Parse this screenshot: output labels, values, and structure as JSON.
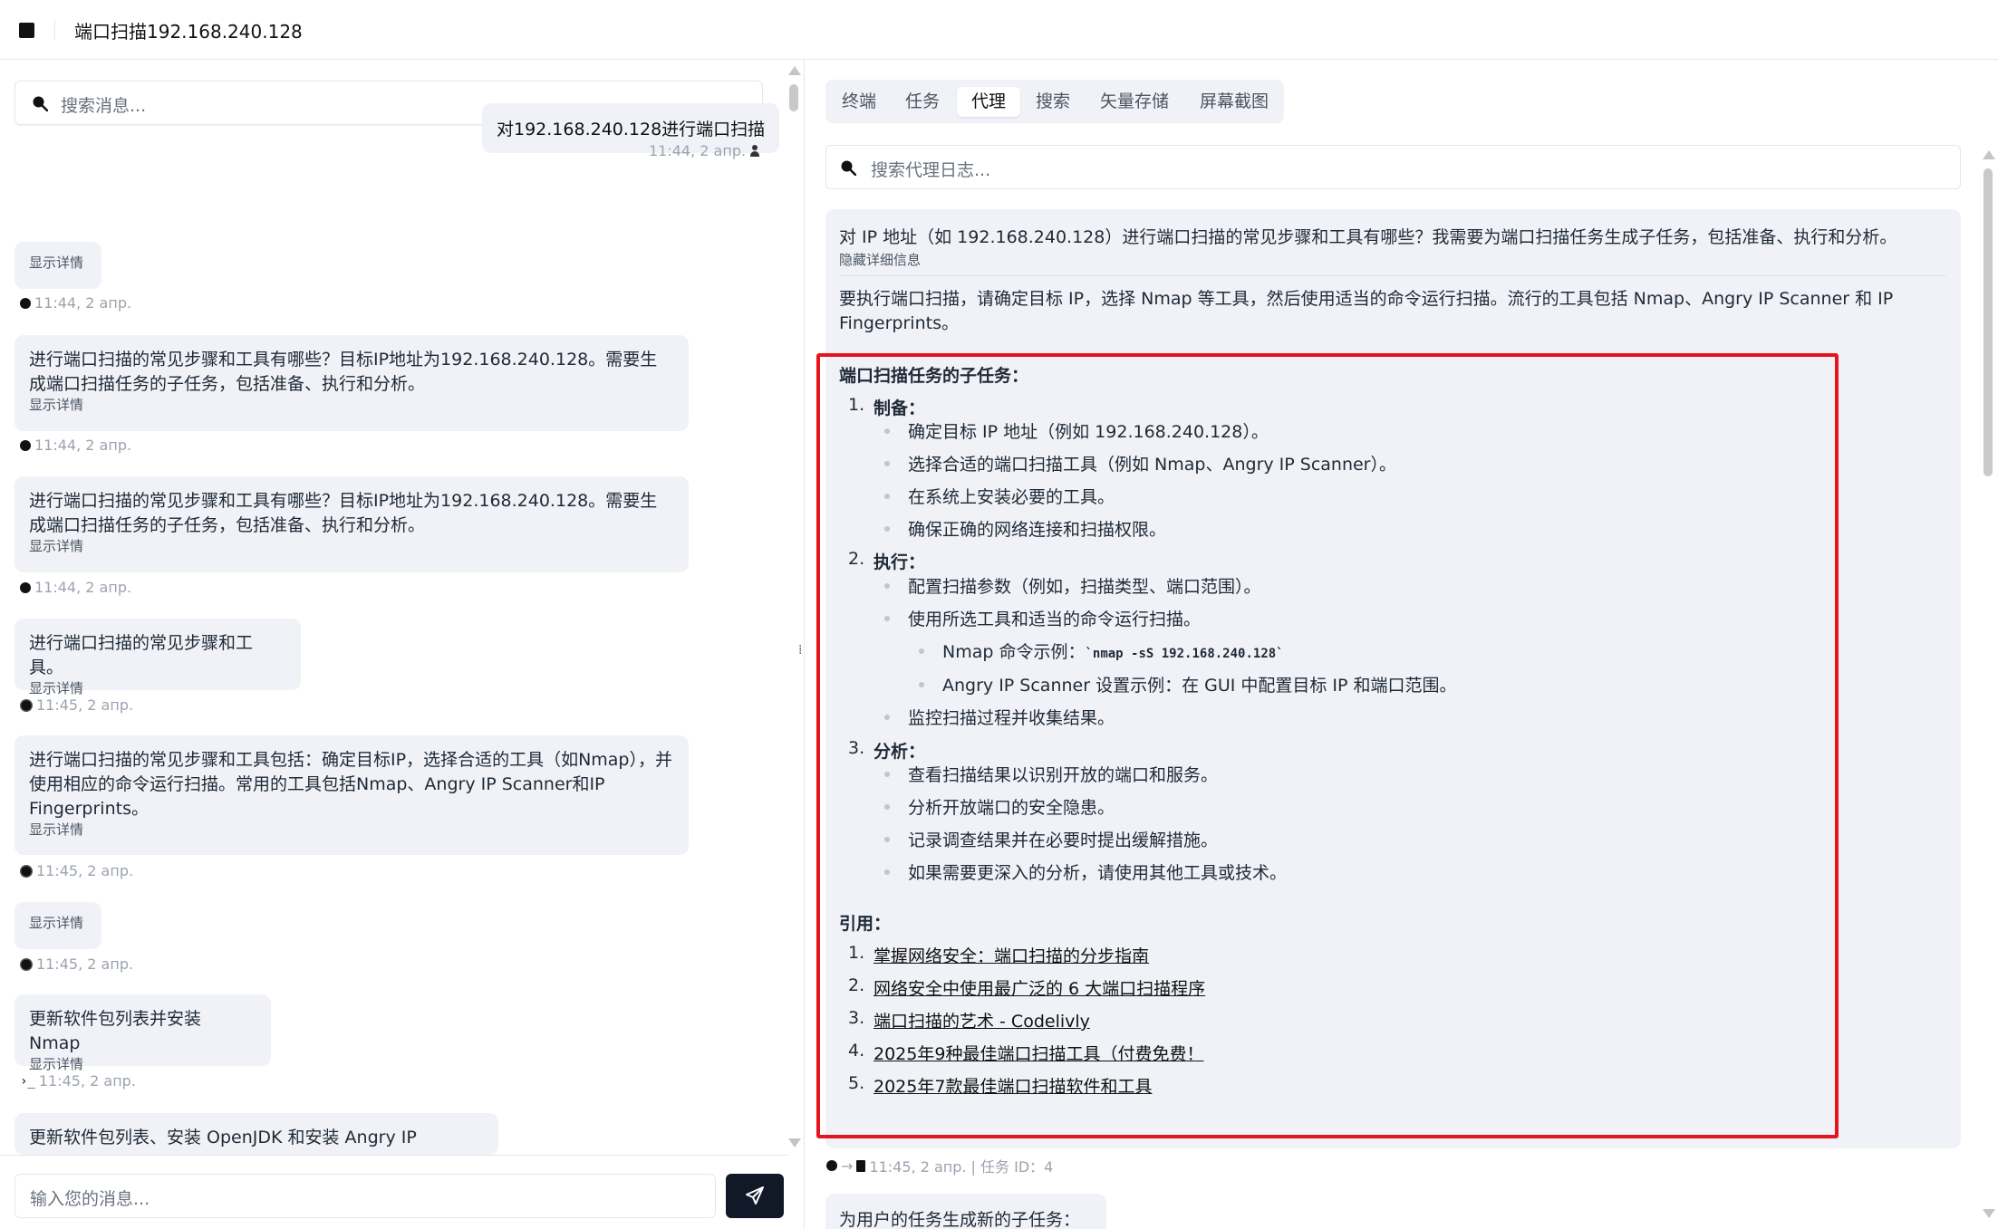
{
  "window": {
    "title": "端口扫描192.168.240.128"
  },
  "left": {
    "search_placeholder": "搜索消息...",
    "input_placeholder": "输入您的消息...",
    "user_message": {
      "text": "对192.168.240.128进行端口扫描",
      "time": "11:44, 2 апр."
    },
    "messages": [
      {
        "text": "",
        "detail": "显示详情",
        "time": "11:44, 2 апр.",
        "icon": "search-icon"
      },
      {
        "text": "进行端口扫描的常见步骤和工具有哪些？目标IP地址为192.168.240.128。需要生成端口扫描任务的子任务，包括准备、执行和分析。",
        "detail": "显示详情",
        "time": "11:44, 2 апр.",
        "icon": "search-icon"
      },
      {
        "text": "进行端口扫描的常见步骤和工具有哪些？目标IP地址为192.168.240.128。需要生成端口扫描任务的子任务，包括准备、执行和分析。",
        "detail": "显示详情",
        "time": "11:44, 2 апр.",
        "icon": "search-icon"
      },
      {
        "text": "进行端口扫描的常见步骤和工具。",
        "detail": "显示详情",
        "time": "11:45, 2 апр.",
        "icon": "ai-icon"
      },
      {
        "text": "进行端口扫描的常见步骤和工具包括：确定目标IP，选择合适的工具（如Nmap），并使用相应的命令运行扫描。常用的工具包括Nmap、Angry IP Scanner和IP Fingerprints。",
        "detail": "显示详情",
        "time": "11:45, 2 апр.",
        "icon": "ai-icon"
      },
      {
        "text": "",
        "detail": "显示详情",
        "time": "11:45, 2 апр.",
        "icon": "ai-icon"
      },
      {
        "text": "更新软件包列表并安装 Nmap",
        "detail": "显示详情",
        "time": "11:45, 2 апр.",
        "icon": "terminal-icon"
      },
      {
        "text": "更新软件包列表、安装 OpenJDK 和安装 Angry IP Scanner",
        "detail": "",
        "time": "",
        "icon": ""
      }
    ]
  },
  "right": {
    "tabs": [
      "终端",
      "任务",
      "代理",
      "搜索",
      "矢量存储",
      "屏幕截图"
    ],
    "active_tab": "代理",
    "search_placeholder": "搜索代理日志...",
    "card": {
      "question": "对 IP 地址（如 192.168.240.128）进行端口扫描的常见步骤和工具有哪些？我需要为端口扫描任务生成子任务，包括准备、执行和分析。",
      "hide_label": "隐藏详细信息",
      "answer": "要执行端口扫描，请确定目标 IP，选择 Nmap 等工具，然后使用适当的命令运行扫描。流行的工具包括 Nmap、Angry IP Scanner 和 IP Fingerprints。",
      "subtasks_heading": "端口扫描任务的子任务：",
      "sections": [
        {
          "num": "1.",
          "title": "制备：",
          "items": [
            "确定目标 IP 地址（例如 192.168.240.128）。",
            "选择合适的端口扫描工具（例如 Nmap、Angry IP Scanner）。",
            "在系统上安装必要的工具。",
            "确保正确的网络连接和扫描权限。"
          ]
        },
        {
          "num": "2.",
          "title": "执行：",
          "items": [
            "配置扫描参数（例如，扫描类型、端口范围）。",
            "使用所选工具和适当的命令运行扫描。",
            "监控扫描过程并收集结果。"
          ],
          "sub_items": {
            "nmap_label": "Nmap 命令示例：",
            "nmap_cmd": "`nmap -sS 192.168.240.128`",
            "angry": "Angry IP Scanner 设置示例：在 GUI 中配置目标 IP 和端口范围。"
          }
        },
        {
          "num": "3.",
          "title": "分析：",
          "items": [
            "查看扫描结果以识别开放的端口和服务。",
            "分析开放端口的安全隐患。",
            "记录调查结果并在必要时提出缓解措施。",
            "如果需要更深入的分析，请使用其他工具或技术。"
          ]
        }
      ],
      "citations_heading": "引用：",
      "citations": [
        {
          "num": "1.",
          "text": "掌握网络安全：端口扫描的分步指南"
        },
        {
          "num": "2.",
          "text": "网络安全中使用最广泛的 6 大端口扫描程序"
        },
        {
          "num": "3.",
          "text": "端口扫描的艺术 - Codelivly"
        },
        {
          "num": "4.",
          "text": "2025年9种最佳端口扫描工具（付费免费！"
        },
        {
          "num": "5.",
          "text": "2025年7款最佳端口扫描软件和工具"
        }
      ],
      "meta": "11:45, 2 апр. | 任务 ID：4"
    },
    "next_card_text": "为用户的任务生成新的子任务："
  }
}
